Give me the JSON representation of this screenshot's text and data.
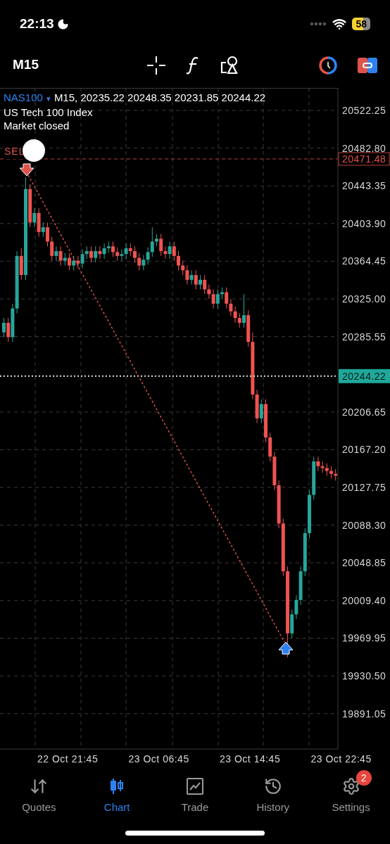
{
  "status_bar": {
    "time": "22:13",
    "battery": "58"
  },
  "toolbar": {
    "timeframe": "M15"
  },
  "chart": {
    "symbol": "NAS100",
    "dropdown": "▾",
    "ohlc": "M15, 20235.22 20248.35 20231.85 20244.22",
    "description": "US Tech 100 Index",
    "market_status": "Market closed",
    "trade_label": "SEL",
    "trade_price": "20471.48",
    "current_price": "20244.22",
    "time_labels": [
      "22 Oct 21:45",
      "23 Oct 06:45",
      "23 Oct 14:45",
      "23 Oct 22:45"
    ],
    "chart_data": {
      "type": "candlestick",
      "ylim": [
        19854,
        20545.8
      ],
      "grid": true,
      "categories": [
        null,
        null,
        null,
        null,
        null,
        null,
        null,
        null,
        null,
        null,
        null,
        null,
        null,
        null,
        null,
        null,
        null,
        null,
        null,
        null,
        null,
        null,
        null,
        null,
        null,
        null,
        null,
        null,
        null,
        null,
        null,
        null,
        null,
        null,
        null,
        null,
        null,
        null,
        null,
        null,
        null,
        null,
        null,
        null,
        null,
        null,
        null,
        null,
        null,
        null,
        null,
        null,
        null,
        null,
        null,
        null,
        null,
        null,
        null,
        null,
        null,
        null,
        null,
        null,
        null,
        null,
        null,
        null,
        null,
        null,
        null,
        null,
        null,
        null,
        null,
        null,
        null
      ],
      "yticks": [
        {
          "value": 20522.25,
          "label": "20522.25"
        },
        {
          "value": 20482.8,
          "label": "20482.80"
        },
        {
          "value": 20443.35,
          "label": "20443.35"
        },
        {
          "value": 20403.9,
          "label": "20403.90"
        },
        {
          "value": 20364.45,
          "label": "20364.45"
        },
        {
          "value": 20325,
          "label": "20325.00"
        },
        {
          "value": 20285.55,
          "label": "20285.55"
        },
        {
          "value": 20206.65,
          "label": "20206.65"
        },
        {
          "value": 20167.2,
          "label": "20167.20"
        },
        {
          "value": 20127.75,
          "label": "20127.75"
        },
        {
          "value": 20088.3,
          "label": "20088.30"
        },
        {
          "value": 20048.85,
          "label": "20048.85"
        },
        {
          "value": 20009.4,
          "label": "20009.40"
        },
        {
          "value": 19969.95,
          "label": "19969.95"
        },
        {
          "value": 19930.5,
          "label": "19930.50"
        },
        {
          "value": 19891.05,
          "label": "19891.05"
        }
      ],
      "ohlc": [
        [
          20290,
          20305,
          20285,
          20300
        ],
        [
          20300,
          20305,
          20280,
          20285
        ],
        [
          20285,
          20320,
          20280,
          20315
        ],
        [
          20315,
          20375,
          20310,
          20370
        ],
        [
          20370,
          20378,
          20345,
          20350
        ],
        [
          20350,
          20452,
          20345,
          20440
        ],
        [
          20440,
          20445,
          20400,
          20405
        ],
        [
          20405,
          20420,
          20400,
          20415
        ],
        [
          20415,
          20420,
          20390,
          20395
        ],
        [
          20395,
          20405,
          20390,
          20400
        ],
        [
          20400,
          20405,
          20380,
          20385
        ],
        [
          20385,
          20390,
          20365,
          20370
        ],
        [
          20370,
          20380,
          20365,
          20375
        ],
        [
          20375,
          20380,
          20360,
          20365
        ],
        [
          20365,
          20373,
          20360,
          20368
        ],
        [
          20368,
          20373,
          20355,
          20360
        ],
        [
          20360,
          20370,
          20355,
          20365
        ],
        [
          20365,
          20370,
          20357,
          20362
        ],
        [
          20362,
          20377,
          20357,
          20372
        ],
        [
          20372,
          20380,
          20367,
          20375
        ],
        [
          20375,
          20380,
          20363,
          20368
        ],
        [
          20368,
          20380,
          20363,
          20375
        ],
        [
          20375,
          20380,
          20367,
          20372
        ],
        [
          20372,
          20383,
          20367,
          20378
        ],
        [
          20378,
          20385,
          20373,
          20380
        ],
        [
          20380,
          20385,
          20369,
          20374
        ],
        [
          20374,
          20379,
          20365,
          20370
        ],
        [
          20370,
          20377,
          20365,
          20372
        ],
        [
          20372,
          20383,
          20367,
          20378
        ],
        [
          20378,
          20383,
          20370,
          20375
        ],
        [
          20375,
          20380,
          20363,
          20368
        ],
        [
          20368,
          20373,
          20355,
          20360
        ],
        [
          20360,
          20371,
          20355,
          20366
        ],
        [
          20366,
          20379,
          20361,
          20374
        ],
        [
          20374,
          20400,
          20369,
          20385
        ],
        [
          20385,
          20393,
          20380,
          20388
        ],
        [
          20388,
          20393,
          20370,
          20375
        ],
        [
          20375,
          20380,
          20367,
          20372
        ],
        [
          20372,
          20385,
          20367,
          20380
        ],
        [
          20380,
          20385,
          20365,
          20370
        ],
        [
          20370,
          20375,
          20355,
          20360
        ],
        [
          20360,
          20365,
          20350,
          20355
        ],
        [
          20355,
          20360,
          20340,
          20345
        ],
        [
          20345,
          20355,
          20340,
          20350
        ],
        [
          20350,
          20355,
          20335,
          20340
        ],
        [
          20340,
          20350,
          20335,
          20345
        ],
        [
          20345,
          20350,
          20330,
          20335
        ],
        [
          20335,
          20340,
          20325,
          20330
        ],
        [
          20330,
          20335,
          20315,
          20320
        ],
        [
          20320,
          20335,
          20315,
          20330
        ],
        [
          20330,
          20337,
          20325,
          20332
        ],
        [
          20332,
          20337,
          20315,
          20320
        ],
        [
          20320,
          20325,
          20307,
          20312
        ],
        [
          20312,
          20317,
          20300,
          20305
        ],
        [
          20305,
          20310,
          20295,
          20300
        ],
        [
          20300,
          20330,
          20295,
          20308
        ],
        [
          20308,
          20313,
          20275,
          20280
        ],
        [
          20280,
          20290,
          20220,
          20225
        ],
        [
          20225,
          20230,
          20195,
          20200
        ],
        [
          20200,
          20220,
          20195,
          20215
        ],
        [
          20215,
          20220,
          20175,
          20180
        ],
        [
          20180,
          20185,
          20155,
          20160
        ],
        [
          20160,
          20165,
          20125,
          20130
        ],
        [
          20130,
          20135,
          20085,
          20090
        ],
        [
          20090,
          20095,
          20035,
          20040
        ],
        [
          20040,
          20045,
          19950,
          19975
        ],
        [
          19975,
          20000,
          19970,
          19995
        ],
        [
          19995,
          20015,
          19990,
          20010
        ],
        [
          20010,
          20045,
          20005,
          20040
        ],
        [
          20040,
          20085,
          20035,
          20080
        ],
        [
          20080,
          20125,
          20075,
          20120
        ],
        [
          20120,
          20160,
          20115,
          20155
        ],
        [
          20155,
          20160,
          20145,
          20150
        ],
        [
          20150,
          20155,
          20143,
          20148
        ],
        [
          20148,
          20153,
          20140,
          20145
        ],
        [
          20145,
          20150,
          20137,
          20142
        ],
        [
          20142,
          20147,
          20135,
          20140
        ]
      ]
    }
  },
  "tabs": [
    {
      "label": "Quotes",
      "kind": "quotes",
      "selected": false
    },
    {
      "label": "Chart",
      "kind": "chart",
      "selected": true
    },
    {
      "label": "Trade",
      "kind": "trade",
      "selected": false
    },
    {
      "label": "History",
      "kind": "history",
      "selected": false
    },
    {
      "label": "Settings",
      "kind": "settings",
      "selected": false,
      "badge": "2"
    }
  ]
}
